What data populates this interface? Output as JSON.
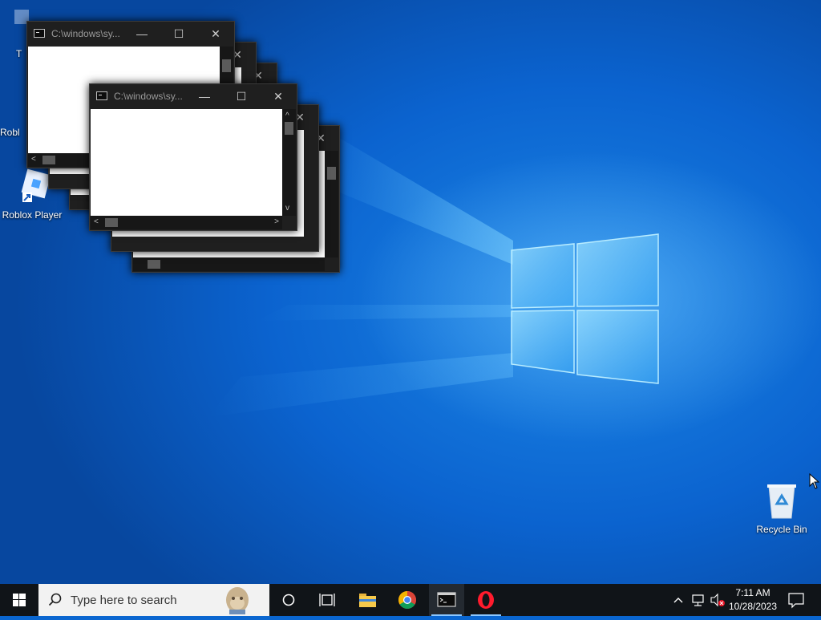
{
  "desktop": {
    "icons": [
      {
        "label": "Robl"
      },
      {
        "label": "Roblox Player"
      },
      {
        "label": "Recycle Bin"
      }
    ],
    "partial_icon_label": "T"
  },
  "console": {
    "title": "C:\\windows\\sy...",
    "minimize_symbol": "—",
    "maximize_symbol": "☐",
    "close_symbol": "✕"
  },
  "taskbar": {
    "search_placeholder": "Type here to search",
    "apps": [
      "Cortana",
      "Task View",
      "File Explorer",
      "Google Chrome",
      "Command Prompt",
      "Opera"
    ],
    "clock_time": "7:11 AM",
    "clock_date": "10/28/2023"
  },
  "colors": {
    "desktop_blue": "#0b63cf",
    "taskbar": "#101418",
    "console_frame": "#1f1f1f"
  }
}
